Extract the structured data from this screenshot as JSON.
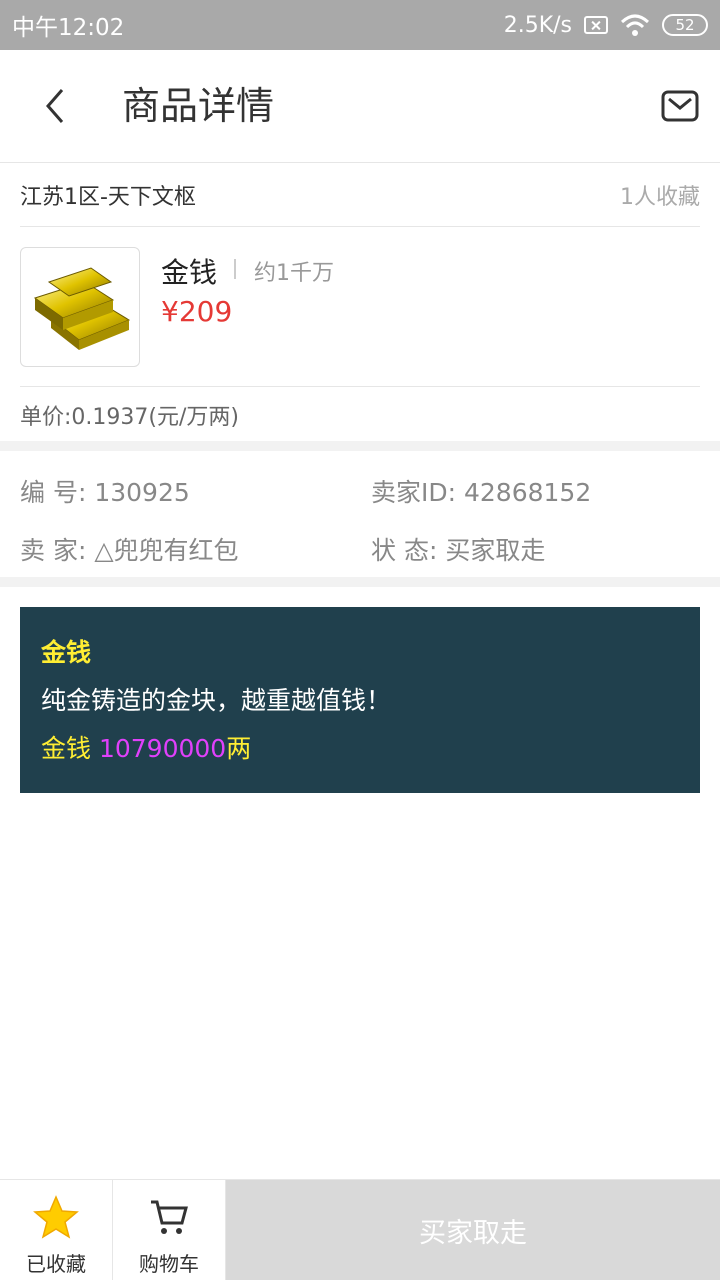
{
  "status_bar": {
    "time": "中午12:02",
    "speed": "2.5K/s",
    "battery": "52"
  },
  "header": {
    "title": "商品详情"
  },
  "server": {
    "name": "江苏1区-天下文枢",
    "favorites": "1人收藏"
  },
  "product": {
    "name": "金钱",
    "approx": "约1千万",
    "price": "¥209",
    "unit_price": "单价:0.1937(元/万两)"
  },
  "details": {
    "id_label": "编  号:",
    "id_value": "130925",
    "seller_id_label": "卖家ID:",
    "seller_id_value": "42868152",
    "seller_label": "卖  家:",
    "seller_value": "△兜兜有红包",
    "status_label": "状  态:",
    "status_value": "买家取走"
  },
  "description": {
    "title": "金钱",
    "text": "纯金铸造的金块，越重越值钱！",
    "amount_label": "金钱 ",
    "amount_value": "10790000",
    "amount_unit": "两"
  },
  "bottom_bar": {
    "favorite_label": "已收藏",
    "cart_label": "购物车",
    "buy_label": "买家取走"
  },
  "colors": {
    "price": "#e53935",
    "desc_bg": "#20404d",
    "desc_title": "#ffee33",
    "desc_amount": "#e040fb",
    "star": "#ffcc00"
  }
}
